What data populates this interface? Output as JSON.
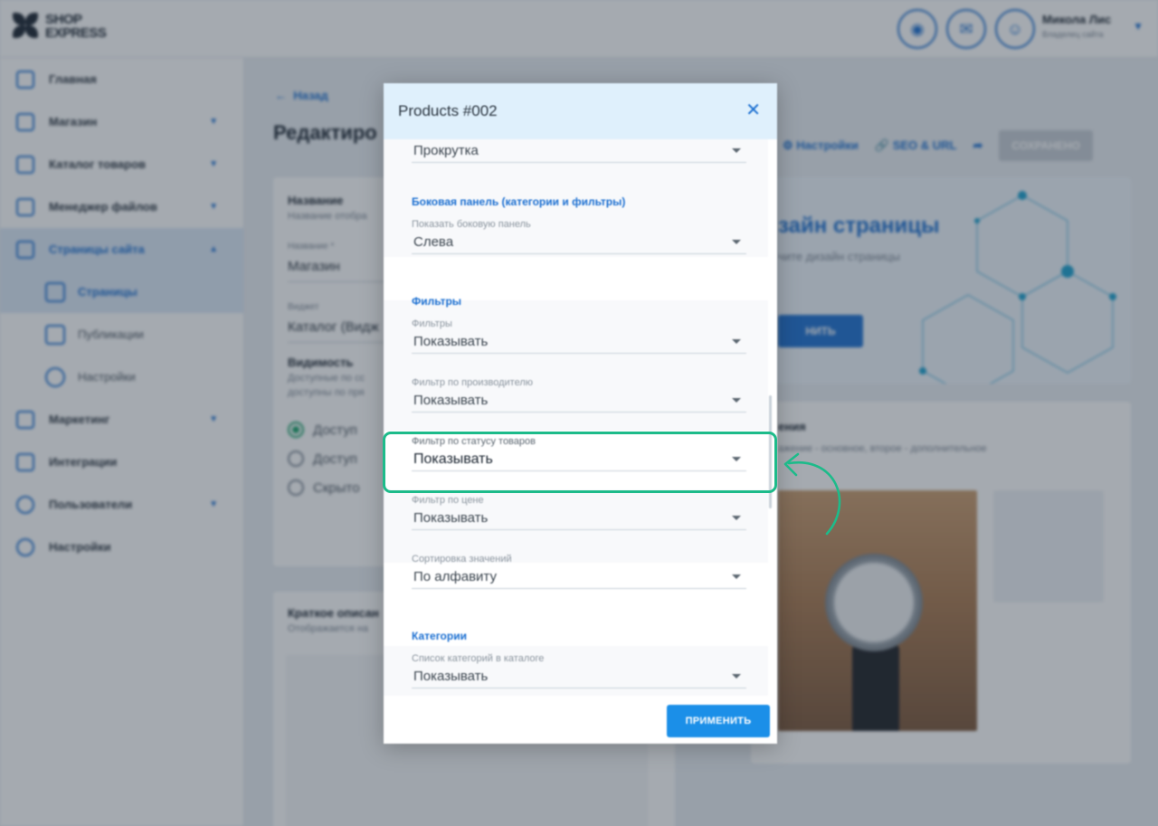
{
  "header": {
    "logo_line1": "SHOP",
    "logo_line2": "EXPRESS",
    "user_name": "Микола Лис",
    "user_role": "Владелец сайта"
  },
  "sidebar": {
    "items": [
      {
        "label": "Главная"
      },
      {
        "label": "Магазин"
      },
      {
        "label": "Каталог товаров"
      },
      {
        "label": "Менеджер файлов"
      },
      {
        "label": "Страницы сайта"
      },
      {
        "label": "Страницы"
      },
      {
        "label": "Публикации"
      },
      {
        "label": "Настройки"
      },
      {
        "label": "Маркетинг"
      },
      {
        "label": "Интеграции"
      },
      {
        "label": "Пользователи"
      },
      {
        "label": "Настройки"
      }
    ]
  },
  "content": {
    "back_label": "Назад",
    "page_title": "Редактиро",
    "toolbar": {
      "settings_label": "Настройки",
      "seo_label": "SEO & URL",
      "save_label": "СОХРАНЕНО"
    },
    "main_card": {
      "title": "Название",
      "subtitle": "Название отобра",
      "name_label": "Название *",
      "name_value": "Магазин",
      "widget_label": "Виджет",
      "widget_value": "Каталог (Видж",
      "visibility_title": "Видимость",
      "visibility_sub1": "Доступные по сс",
      "visibility_sub2": "доступны по пря",
      "radio1": "Доступ",
      "radio2": "Доступ",
      "radio3": "Скрыто"
    },
    "editor_card": {
      "title": "Краткое описан",
      "subtitle": "Отображается на"
    },
    "design_card": {
      "title": "зайн страницы",
      "subtitle": "чите дизайн страницы",
      "button": "НИТЬ"
    },
    "image_card": {
      "title": "ения",
      "subtitle": "ажение - основное, второе - дополнительное"
    }
  },
  "modal": {
    "title": "Products #002",
    "apply_label": "ПРИМЕНИТЬ",
    "fields": {
      "scroll": {
        "label": "",
        "value": "Прокрутка"
      },
      "sidebar_show": {
        "label": "Показать боковую панель",
        "value": "Слева"
      },
      "filters": {
        "label": "Фильтры",
        "value": "Показывать"
      },
      "by_manufacturer": {
        "label": "Фильтр по производителю",
        "value": "Показывать"
      },
      "by_status": {
        "label": "Фильтр по статусу товаров",
        "value": "Показывать"
      },
      "by_price": {
        "label": "Фильтр по цене",
        "value": "Показывать"
      },
      "sort_values": {
        "label": "Сортировка значений",
        "value": "По алфавиту"
      },
      "category_list": {
        "label": "Список категорий в каталоге",
        "value": "Показывать"
      }
    },
    "sections": {
      "sidebar": "Боковая панель (категории и фильтры)",
      "filters": "Фильтры",
      "categories": "Категории"
    }
  },
  "colors": {
    "accent": "#1b6fd1",
    "highlight": "#1dbb8a",
    "modal_header": "#dff0fc",
    "apply_button": "#1b8fe8"
  }
}
